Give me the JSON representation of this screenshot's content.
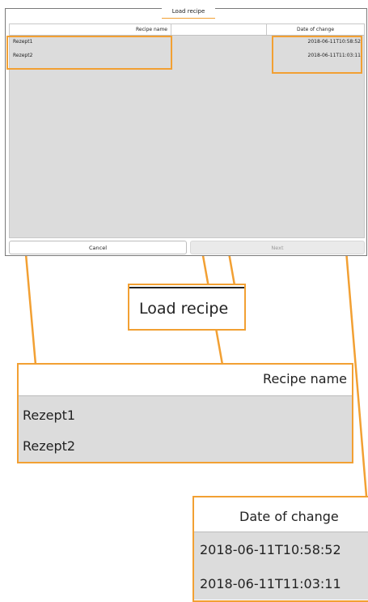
{
  "dialog": {
    "title": "Load recipe",
    "columns": {
      "name": "Recipe name",
      "date": "Date of change"
    },
    "rows": [
      {
        "name": "Rezept1",
        "date": "2018-06-11T10:58:52"
      },
      {
        "name": "Rezept2",
        "date": "2018-06-11T11:03:11"
      }
    ],
    "buttons": {
      "cancel": "Cancel",
      "next": "Next"
    }
  },
  "zooms": {
    "title": "Load recipe",
    "name_header": "Recipe name",
    "name_rows": [
      "Rezept1",
      "Rezept2"
    ],
    "date_header": "Date of change",
    "date_rows": [
      "2018-06-11T10:58:52",
      "2018-06-11T11:03:11"
    ]
  },
  "colors": {
    "highlight": "#f2a033",
    "table_bg": "#dcdcdc"
  }
}
